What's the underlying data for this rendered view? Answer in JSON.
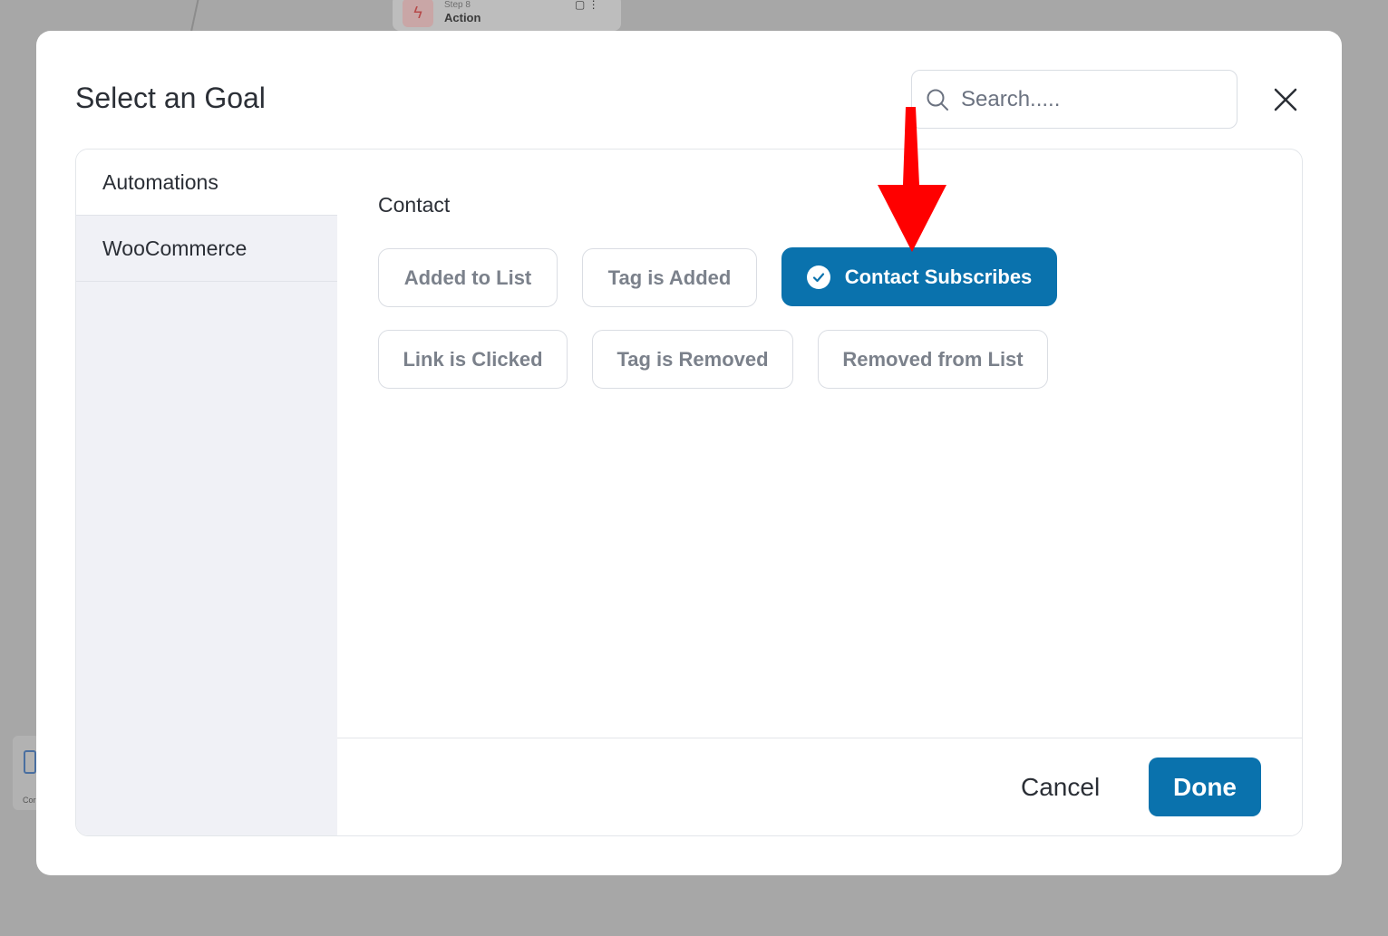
{
  "background": {
    "node_step": "Step 8",
    "node_title": "Action",
    "card_text": "Cor"
  },
  "modal": {
    "title": "Select an Goal",
    "search": {
      "placeholder": "Search....."
    },
    "sidebar": {
      "items": [
        {
          "label": "Automations",
          "active": true
        },
        {
          "label": "WooCommerce",
          "active": false
        }
      ]
    },
    "content": {
      "section_label": "Contact",
      "options": [
        {
          "label": "Added to List",
          "selected": false
        },
        {
          "label": "Tag is Added",
          "selected": false
        },
        {
          "label": "Contact Subscribes",
          "selected": true
        },
        {
          "label": "Link is Clicked",
          "selected": false
        },
        {
          "label": "Tag is Removed",
          "selected": false
        },
        {
          "label": "Removed from List",
          "selected": false
        }
      ]
    },
    "footer": {
      "cancel_label": "Cancel",
      "done_label": "Done"
    }
  },
  "colors": {
    "accent": "#0a72ad",
    "overlay": "#a7a7a7",
    "annotation": "#ff0000"
  }
}
